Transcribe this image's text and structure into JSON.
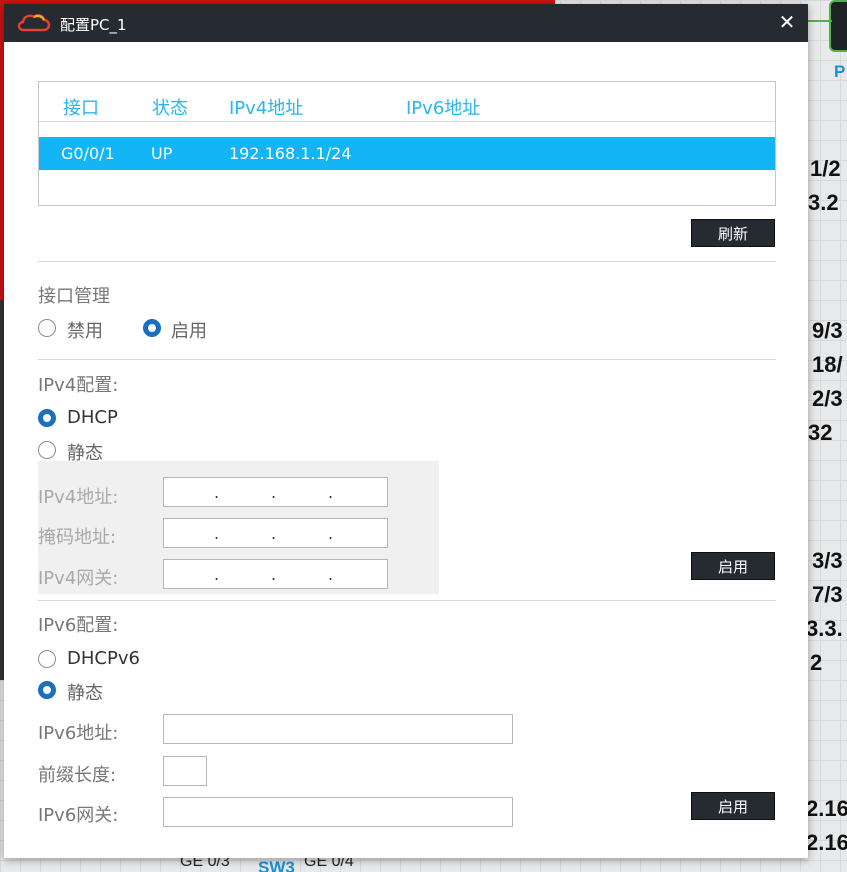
{
  "background": {
    "right_fragments": [
      "1/2",
      "3.2",
      "9/3",
      "18/",
      "2/3",
      "32",
      "3/3",
      "7/3",
      "3.3.",
      "2",
      "2.16",
      "2.16"
    ],
    "top_right_label": "P",
    "bottom_left_label": "GE 0/3",
    "bottom_mid_label": "SW3",
    "bottom_right_label": "GE 0/4"
  },
  "dialog": {
    "title": "配置PC_1",
    "close_glyph": "✕",
    "interfaces": {
      "columns": [
        "接口",
        "状态",
        "IPv4地址",
        "IPv6地址"
      ],
      "rows": [
        {
          "interface": "G0/0/1",
          "status": "UP",
          "ipv4": "192.168.1.1/24",
          "ipv6": ""
        }
      ]
    },
    "refresh_label": "刷新",
    "iface_mgmt": {
      "title": "接口管理",
      "options": [
        {
          "label": "禁用",
          "selected": false
        },
        {
          "label": "启用",
          "selected": true
        }
      ]
    },
    "ipv4": {
      "title": "IPv4配置:",
      "options": [
        {
          "label": "DHCP",
          "selected": true
        },
        {
          "label": "静态",
          "selected": false
        }
      ],
      "fields": [
        {
          "label": "IPv4地址:",
          "value": ""
        },
        {
          "label": "掩码地址:",
          "value": ""
        },
        {
          "label": "IPv4网关:",
          "value": ""
        }
      ],
      "apply_label": "启用"
    },
    "ipv6": {
      "title": "IPv6配置:",
      "options": [
        {
          "label": "DHCPv6",
          "selected": false
        },
        {
          "label": "静态",
          "selected": true
        }
      ],
      "fields": [
        {
          "label": "IPv6地址:",
          "value": ""
        },
        {
          "label": "前缀长度:",
          "value": ""
        },
        {
          "label": "IPv6网关:",
          "value": ""
        }
      ],
      "apply_label": "启用"
    }
  },
  "colors": {
    "titlebar": "#252b31",
    "accent": "#13b5f6",
    "header_text": "#29b6ea",
    "radio_selected": "#1b6fbf"
  }
}
